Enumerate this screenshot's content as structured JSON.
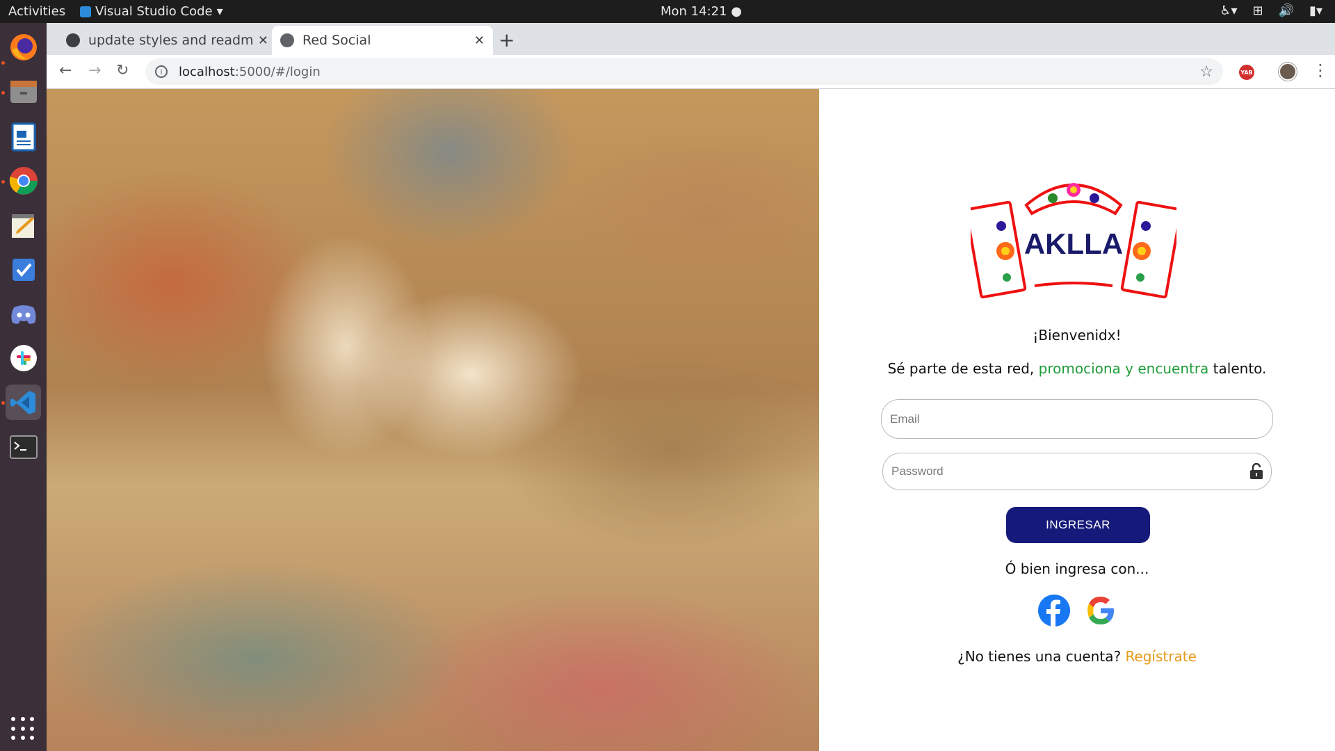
{
  "system": {
    "activities": "Activities",
    "app_menu": "Visual Studio Code",
    "clock": "Mon 14:21"
  },
  "dock": {
    "items": [
      "firefox-icon",
      "files-icon",
      "writer-icon",
      "chrome-icon",
      "text-editor-icon",
      "tasks-icon",
      "discord-icon",
      "slack-icon",
      "vscode-icon",
      "terminal-icon"
    ]
  },
  "browser": {
    "tabs": [
      {
        "title": "update styles and readme"
      },
      {
        "title": "Red Social"
      }
    ],
    "url_host": "localhost",
    "url_path": ":5000/#/login",
    "extension_label": "YAB"
  },
  "login": {
    "logo_text": "AKLLA",
    "welcome": "¡Bienvenidx!",
    "tagline_start": "Sé parte de esta red, ",
    "tagline_highlight": "promociona y encuentra",
    "tagline_end": " talento.",
    "email_placeholder": "Email",
    "password_placeholder": "Password",
    "submit_label": "INGRESAR",
    "alt_login": "Ó bien ingresa con...",
    "signup_prompt": "¿No tienes una cuenta? ",
    "signup_link": "Regístrate"
  },
  "colors": {
    "primary_button": "#151a7a",
    "highlight_green": "#1f9d3a",
    "signup_orange": "#e69a1a"
  }
}
